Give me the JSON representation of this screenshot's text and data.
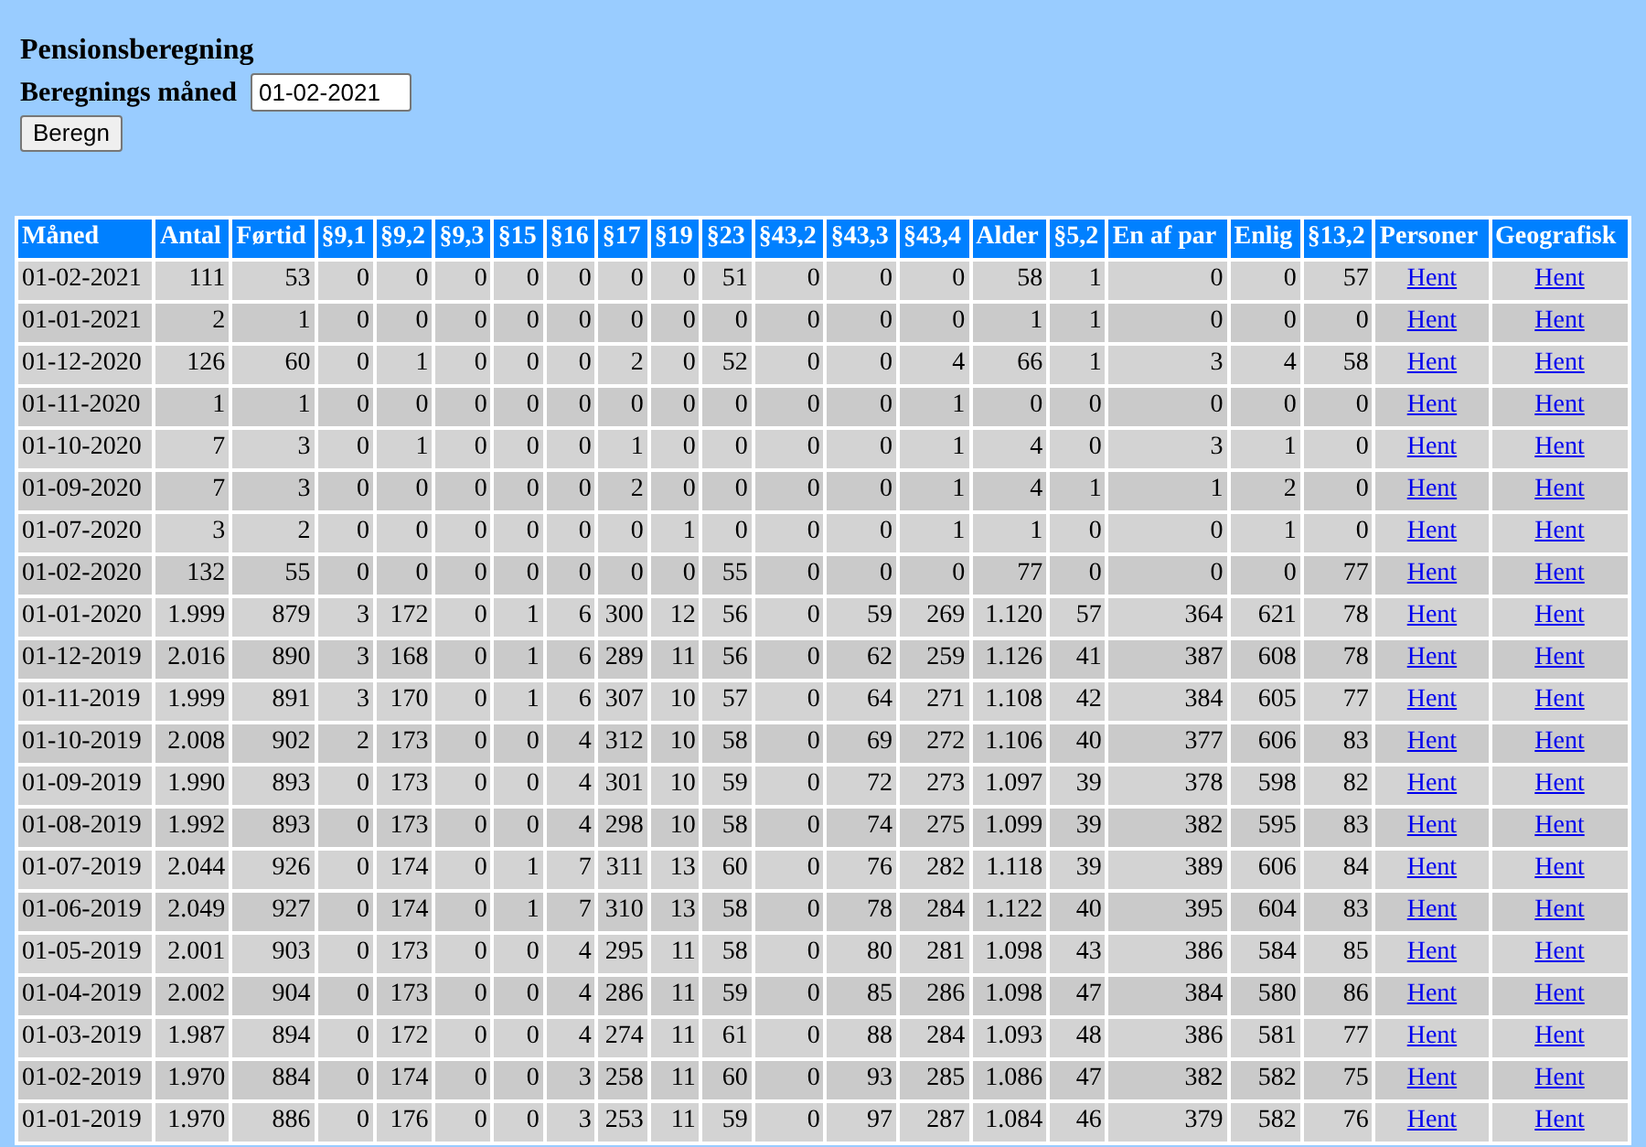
{
  "title": "Pensionsberegning",
  "form": {
    "label": "Beregnings måned",
    "value": "01-02-2021",
    "button": "Beregn"
  },
  "table": {
    "columns": [
      "Måned",
      "Antal",
      "Førtid",
      "§9,1",
      "§9,2",
      "§9,3",
      "§15",
      "§16",
      "§17",
      "§19",
      "§23",
      "§43,2",
      "§43,3",
      "§43,4",
      "Alder",
      "§5,2",
      "En af par",
      "Enlig",
      "§13,2",
      "Personer",
      "Geografisk"
    ],
    "rows": [
      {
        "cells": [
          "01-02-2021",
          "111",
          "53",
          "0",
          "0",
          "0",
          "0",
          "0",
          "0",
          "0",
          "51",
          "0",
          "0",
          "0",
          "58",
          "1",
          "0",
          "0",
          "57"
        ],
        "links": [
          "Hent",
          "Hent"
        ]
      },
      {
        "cells": [
          "01-01-2021",
          "2",
          "1",
          "0",
          "0",
          "0",
          "0",
          "0",
          "0",
          "0",
          "0",
          "0",
          "0",
          "0",
          "1",
          "1",
          "0",
          "0",
          "0"
        ],
        "links": [
          "Hent",
          "Hent"
        ]
      },
      {
        "cells": [
          "01-12-2020",
          "126",
          "60",
          "0",
          "1",
          "0",
          "0",
          "0",
          "2",
          "0",
          "52",
          "0",
          "0",
          "4",
          "66",
          "1",
          "3",
          "4",
          "58"
        ],
        "links": [
          "Hent",
          "Hent"
        ]
      },
      {
        "cells": [
          "01-11-2020",
          "1",
          "1",
          "0",
          "0",
          "0",
          "0",
          "0",
          "0",
          "0",
          "0",
          "0",
          "0",
          "1",
          "0",
          "0",
          "0",
          "0",
          "0"
        ],
        "links": [
          "Hent",
          "Hent"
        ]
      },
      {
        "cells": [
          "01-10-2020",
          "7",
          "3",
          "0",
          "1",
          "0",
          "0",
          "0",
          "1",
          "0",
          "0",
          "0",
          "0",
          "1",
          "4",
          "0",
          "3",
          "1",
          "0"
        ],
        "links": [
          "Hent",
          "Hent"
        ]
      },
      {
        "cells": [
          "01-09-2020",
          "7",
          "3",
          "0",
          "0",
          "0",
          "0",
          "0",
          "2",
          "0",
          "0",
          "0",
          "0",
          "1",
          "4",
          "1",
          "1",
          "2",
          "0"
        ],
        "links": [
          "Hent",
          "Hent"
        ]
      },
      {
        "cells": [
          "01-07-2020",
          "3",
          "2",
          "0",
          "0",
          "0",
          "0",
          "0",
          "0",
          "1",
          "0",
          "0",
          "0",
          "1",
          "1",
          "0",
          "0",
          "1",
          "0"
        ],
        "links": [
          "Hent",
          "Hent"
        ]
      },
      {
        "cells": [
          "01-02-2020",
          "132",
          "55",
          "0",
          "0",
          "0",
          "0",
          "0",
          "0",
          "0",
          "55",
          "0",
          "0",
          "0",
          "77",
          "0",
          "0",
          "0",
          "77"
        ],
        "links": [
          "Hent",
          "Hent"
        ]
      },
      {
        "cells": [
          "01-01-2020",
          "1.999",
          "879",
          "3",
          "172",
          "0",
          "1",
          "6",
          "300",
          "12",
          "56",
          "0",
          "59",
          "269",
          "1.120",
          "57",
          "364",
          "621",
          "78"
        ],
        "links": [
          "Hent",
          "Hent"
        ]
      },
      {
        "cells": [
          "01-12-2019",
          "2.016",
          "890",
          "3",
          "168",
          "0",
          "1",
          "6",
          "289",
          "11",
          "56",
          "0",
          "62",
          "259",
          "1.126",
          "41",
          "387",
          "608",
          "78"
        ],
        "links": [
          "Hent",
          "Hent"
        ]
      },
      {
        "cells": [
          "01-11-2019",
          "1.999",
          "891",
          "3",
          "170",
          "0",
          "1",
          "6",
          "307",
          "10",
          "57",
          "0",
          "64",
          "271",
          "1.108",
          "42",
          "384",
          "605",
          "77"
        ],
        "links": [
          "Hent",
          "Hent"
        ]
      },
      {
        "cells": [
          "01-10-2019",
          "2.008",
          "902",
          "2",
          "173",
          "0",
          "0",
          "4",
          "312",
          "10",
          "58",
          "0",
          "69",
          "272",
          "1.106",
          "40",
          "377",
          "606",
          "83"
        ],
        "links": [
          "Hent",
          "Hent"
        ]
      },
      {
        "cells": [
          "01-09-2019",
          "1.990",
          "893",
          "0",
          "173",
          "0",
          "0",
          "4",
          "301",
          "10",
          "59",
          "0",
          "72",
          "273",
          "1.097",
          "39",
          "378",
          "598",
          "82"
        ],
        "links": [
          "Hent",
          "Hent"
        ]
      },
      {
        "cells": [
          "01-08-2019",
          "1.992",
          "893",
          "0",
          "173",
          "0",
          "0",
          "4",
          "298",
          "10",
          "58",
          "0",
          "74",
          "275",
          "1.099",
          "39",
          "382",
          "595",
          "83"
        ],
        "links": [
          "Hent",
          "Hent"
        ]
      },
      {
        "cells": [
          "01-07-2019",
          "2.044",
          "926",
          "0",
          "174",
          "0",
          "1",
          "7",
          "311",
          "13",
          "60",
          "0",
          "76",
          "282",
          "1.118",
          "39",
          "389",
          "606",
          "84"
        ],
        "links": [
          "Hent",
          "Hent"
        ]
      },
      {
        "cells": [
          "01-06-2019",
          "2.049",
          "927",
          "0",
          "174",
          "0",
          "1",
          "7",
          "310",
          "13",
          "58",
          "0",
          "78",
          "284",
          "1.122",
          "40",
          "395",
          "604",
          "83"
        ],
        "links": [
          "Hent",
          "Hent"
        ]
      },
      {
        "cells": [
          "01-05-2019",
          "2.001",
          "903",
          "0",
          "173",
          "0",
          "0",
          "4",
          "295",
          "11",
          "58",
          "0",
          "80",
          "281",
          "1.098",
          "43",
          "386",
          "584",
          "85"
        ],
        "links": [
          "Hent",
          "Hent"
        ]
      },
      {
        "cells": [
          "01-04-2019",
          "2.002",
          "904",
          "0",
          "173",
          "0",
          "0",
          "4",
          "286",
          "11",
          "59",
          "0",
          "85",
          "286",
          "1.098",
          "47",
          "384",
          "580",
          "86"
        ],
        "links": [
          "Hent",
          "Hent"
        ]
      },
      {
        "cells": [
          "01-03-2019",
          "1.987",
          "894",
          "0",
          "172",
          "0",
          "0",
          "4",
          "274",
          "11",
          "61",
          "0",
          "88",
          "284",
          "1.093",
          "48",
          "386",
          "581",
          "77"
        ],
        "links": [
          "Hent",
          "Hent"
        ]
      },
      {
        "cells": [
          "01-02-2019",
          "1.970",
          "884",
          "0",
          "174",
          "0",
          "0",
          "3",
          "258",
          "11",
          "60",
          "0",
          "93",
          "285",
          "1.086",
          "47",
          "382",
          "582",
          "75"
        ],
        "links": [
          "Hent",
          "Hent"
        ]
      },
      {
        "cells": [
          "01-01-2019",
          "1.970",
          "886",
          "0",
          "176",
          "0",
          "0",
          "3",
          "253",
          "11",
          "59",
          "0",
          "97",
          "287",
          "1.084",
          "46",
          "379",
          "582",
          "76"
        ],
        "links": [
          "Hent",
          "Hent"
        ]
      }
    ]
  }
}
